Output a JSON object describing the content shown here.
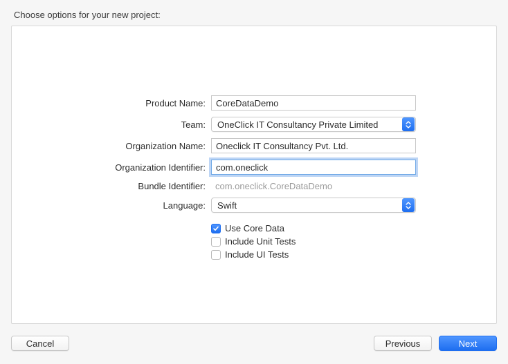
{
  "header": "Choose options for your new project:",
  "labels": {
    "productName": "Product Name:",
    "team": "Team:",
    "orgName": "Organization Name:",
    "orgId": "Organization Identifier:",
    "bundleId": "Bundle Identifier:",
    "language": "Language:"
  },
  "values": {
    "productName": "CoreDataDemo",
    "team": "OneClick IT Consultancy Private Limited",
    "orgName": "Oneclick IT Consultancy Pvt. Ltd.",
    "orgId": "com.oneclick",
    "bundleId": "com.oneclick.CoreDataDemo",
    "language": "Swift"
  },
  "checks": {
    "useCoreData": {
      "label": "Use Core Data",
      "checked": true
    },
    "includeUnitTests": {
      "label": "Include Unit Tests",
      "checked": false
    },
    "includeUITests": {
      "label": "Include UI Tests",
      "checked": false
    }
  },
  "buttons": {
    "cancel": "Cancel",
    "previous": "Previous",
    "next": "Next"
  }
}
